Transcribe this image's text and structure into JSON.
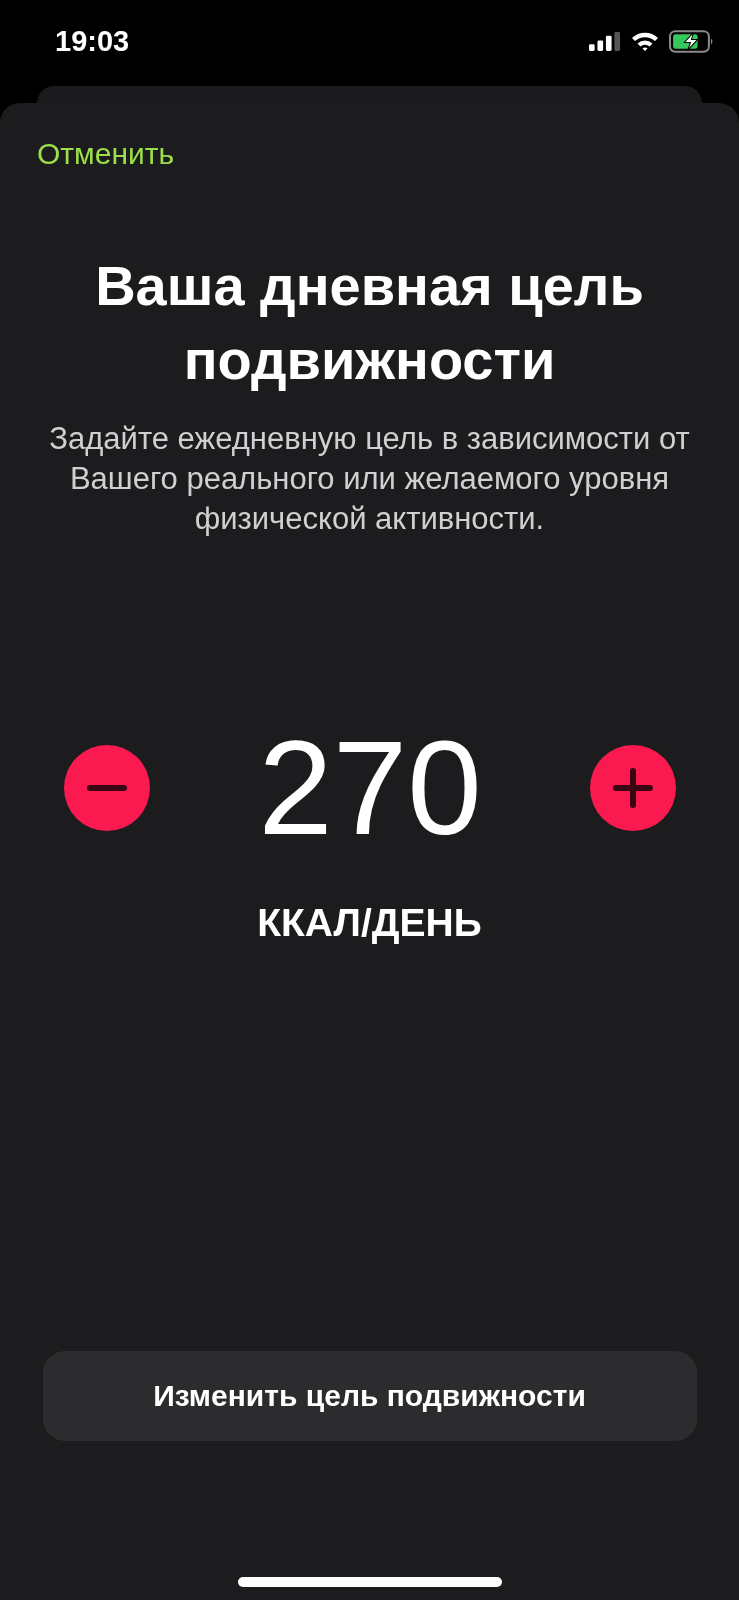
{
  "status_bar": {
    "time": "19:03"
  },
  "sheet": {
    "cancel": "Отменить",
    "title": "Ваша дневная цель подвижности",
    "subtitle": "Задайте ежедневную цель в зависимости от Вашего реального или желаемого уровня физической активности.",
    "goal": {
      "value": "270",
      "unit": "ККАЛ/ДЕНЬ"
    },
    "action_button": "Изменить цель подвижности"
  }
}
